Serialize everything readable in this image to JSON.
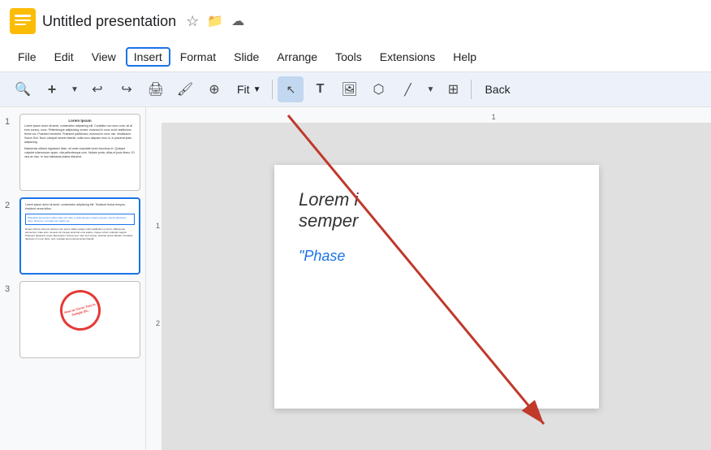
{
  "titleBar": {
    "appName": "Untitled presentation",
    "starIcon": "☆",
    "cloudIcon": "⊙",
    "saveIcon": "⊕"
  },
  "menuBar": {
    "items": [
      {
        "id": "file",
        "label": "File"
      },
      {
        "id": "edit",
        "label": "Edit"
      },
      {
        "id": "view",
        "label": "View"
      },
      {
        "id": "insert",
        "label": "Insert",
        "highlighted": true
      },
      {
        "id": "format",
        "label": "Format"
      },
      {
        "id": "slide",
        "label": "Slide"
      },
      {
        "id": "arrange",
        "label": "Arrange"
      },
      {
        "id": "tools",
        "label": "Tools"
      },
      {
        "id": "extensions",
        "label": "Extensions"
      },
      {
        "id": "help",
        "label": "Help"
      }
    ]
  },
  "toolbar": {
    "zoomLabel": "Fit",
    "backLabel": "Back"
  },
  "slides": [
    {
      "number": "1",
      "type": "text",
      "title": "Lorem Ipsum",
      "selected": false
    },
    {
      "number": "2",
      "type": "bluebox",
      "selected": true
    },
    {
      "number": "3",
      "type": "circle",
      "selected": false
    }
  ],
  "canvas": {
    "mainText": "Lorem i semper",
    "blueText": "\"Phase"
  },
  "ruler": {
    "topMark": "1",
    "leftMarks": [
      "1",
      "2"
    ]
  }
}
